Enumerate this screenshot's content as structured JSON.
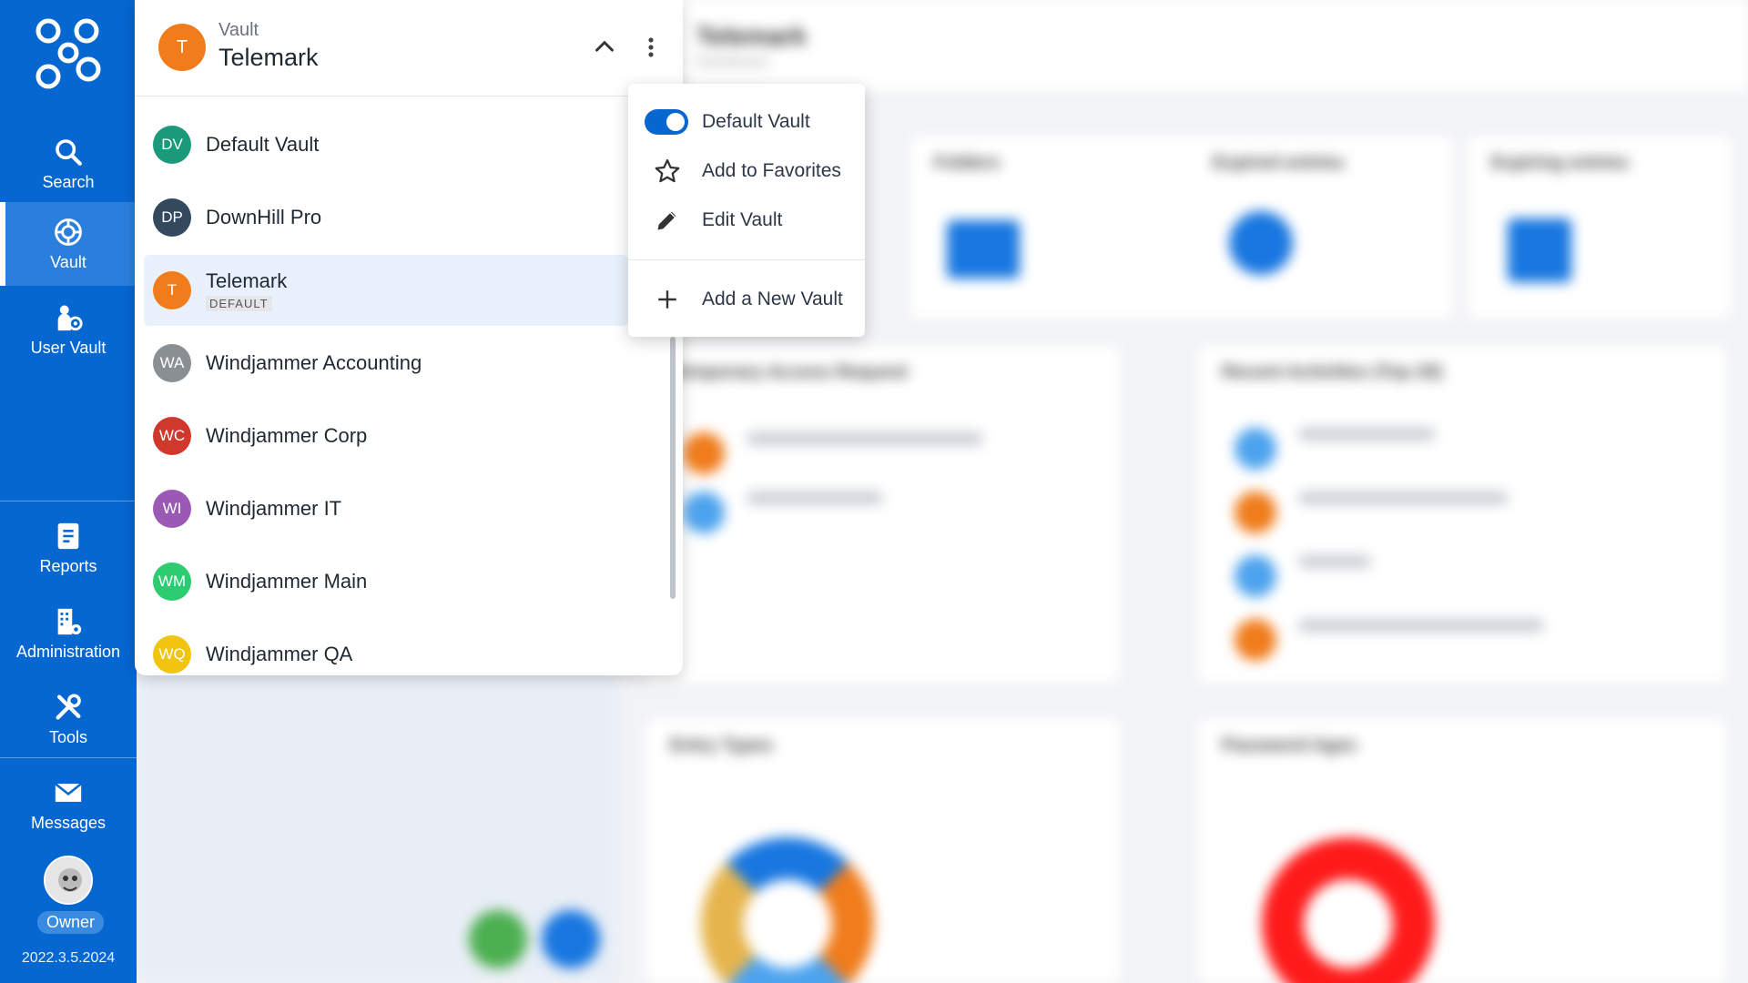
{
  "nav": {
    "items": [
      {
        "label": "Search",
        "icon": "search-icon"
      },
      {
        "label": "Vault",
        "icon": "vault-icon"
      },
      {
        "label": "User Vault",
        "icon": "user-vault-icon"
      },
      {
        "label": "Reports",
        "icon": "reports-icon"
      },
      {
        "label": "Administration",
        "icon": "administration-icon"
      },
      {
        "label": "Tools",
        "icon": "tools-icon"
      },
      {
        "label": "Messages",
        "icon": "messages-icon"
      }
    ],
    "active": "Vault",
    "owner_badge": "Owner",
    "version": "2022.3.5.2024",
    "color": "#0667d0"
  },
  "vault_panel": {
    "header_label": "Vault",
    "header_name": "Telemark",
    "header_initials": "T",
    "vaults": [
      {
        "initials": "DV",
        "name": "Default Vault",
        "color": "#1a9a7a"
      },
      {
        "initials": "DP",
        "name": "DownHill Pro",
        "color": "#34495e"
      },
      {
        "initials": "T",
        "name": "Telemark",
        "color": "#f07c1b",
        "tag": "DEFAULT"
      },
      {
        "initials": "WA",
        "name": "Windjammer Accounting",
        "color": "#8a8f94"
      },
      {
        "initials": "WC",
        "name": "Windjammer Corp",
        "color": "#d0382b"
      },
      {
        "initials": "WI",
        "name": "Windjammer IT",
        "color": "#9b59b6"
      },
      {
        "initials": "WM",
        "name": "Windjammer Main",
        "color": "#2ecc71"
      },
      {
        "initials": "WQ",
        "name": "Windjammer QA",
        "color": "#f1c40f"
      }
    ]
  },
  "context_menu": {
    "default_vault": "Default Vault",
    "add_to_favorites": "Add to Favorites",
    "edit_vault": "Edit Vault",
    "add_new_vault": "Add a New Vault",
    "default_toggle_on": true
  }
}
